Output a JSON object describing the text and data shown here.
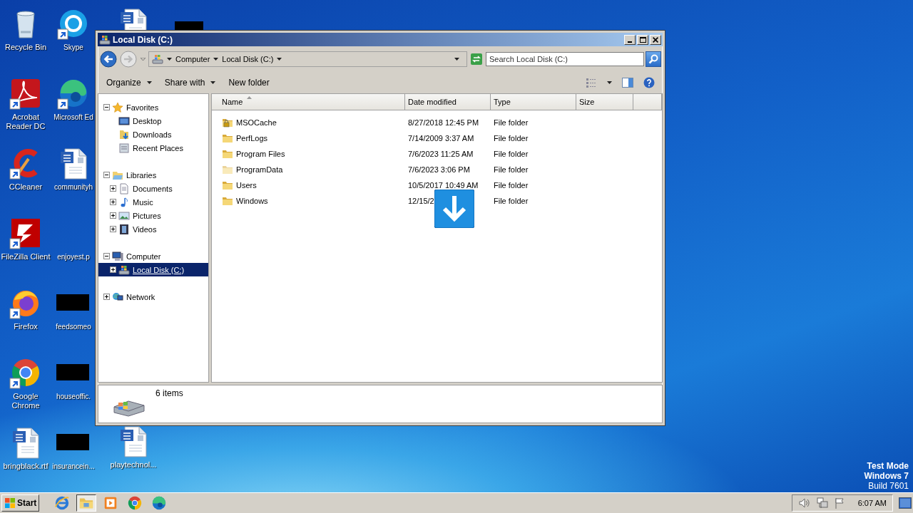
{
  "desktop": {
    "columns": [
      [
        {
          "label": "Recycle Bin",
          "kind": "recycle-bin",
          "shortcut": false
        },
        {
          "label": "Acrobat Reader DC",
          "kind": "acrobat",
          "shortcut": true
        },
        {
          "label": "CCleaner",
          "kind": "ccleaner",
          "shortcut": true
        },
        {
          "label": "FileZilla Client",
          "kind": "filezilla",
          "shortcut": true
        },
        {
          "label": "Firefox",
          "kind": "firefox",
          "shortcut": true
        },
        {
          "label": "Google Chrome",
          "kind": "chrome",
          "shortcut": true
        },
        {
          "label": "bringblack.rtf",
          "kind": "word-doc",
          "shortcut": false
        }
      ],
      [
        {
          "label": "Skype",
          "kind": "skype",
          "shortcut": true
        },
        {
          "label": "Microsoft Ed",
          "kind": "edge",
          "shortcut": true
        },
        {
          "label": "communityh",
          "kind": "word-doc",
          "shortcut": false
        },
        {
          "label": "enjoyest.p",
          "kind": "blank"
        },
        {
          "label": "feedsomeo",
          "kind": "redacted"
        },
        {
          "label": "houseoffic.",
          "kind": "redacted"
        },
        {
          "label": "insurancein...",
          "kind": "redacted"
        }
      ],
      [
        {
          "kind": "word-doc",
          "shortcut": false
        },
        {
          "label": "playtechnol...",
          "kind": "word-doc",
          "shortcut": false
        }
      ],
      [
        {
          "kind": "redacted"
        }
      ]
    ],
    "system_text": [
      "Test Mode",
      "Windows 7",
      "Build 7601"
    ]
  },
  "window": {
    "title": "Local Disk (C:)",
    "address": {
      "crumbs": [
        "Computer",
        "Local Disk (C:)"
      ]
    },
    "search": {
      "placeholder": "Search Local Disk (C:)"
    },
    "commands": [
      {
        "label": "Organize",
        "menu": true
      },
      {
        "label": "Share with",
        "menu": true
      },
      {
        "label": "New folder",
        "menu": false
      }
    ],
    "navigation": [
      {
        "label": "Favorites",
        "kind": "star",
        "expanded": true,
        "selected": false,
        "children": [
          {
            "label": "Desktop",
            "kind": "desktop",
            "selected": false
          },
          {
            "label": "Downloads",
            "kind": "downloads",
            "selected": false
          },
          {
            "label": "Recent Places",
            "kind": "recent",
            "selected": false
          }
        ]
      },
      {
        "label": "Libraries",
        "kind": "libraries",
        "expanded": true,
        "selected": false,
        "children": [
          {
            "label": "Documents",
            "kind": "documents",
            "expanded": false,
            "selected": false
          },
          {
            "label": "Music",
            "kind": "music",
            "expanded": false,
            "selected": false
          },
          {
            "label": "Pictures",
            "kind": "pictures",
            "expanded": false,
            "selected": false
          },
          {
            "label": "Videos",
            "kind": "videos",
            "expanded": false,
            "selected": false
          }
        ]
      },
      {
        "label": "Computer",
        "kind": "computer",
        "expanded": true,
        "selected": false,
        "children": [
          {
            "label": "Local Disk (C:)",
            "kind": "drive",
            "expanded": false,
            "selected": true
          }
        ]
      },
      {
        "label": "Network",
        "kind": "network",
        "expanded": false,
        "selected": false
      }
    ],
    "columns": [
      {
        "label": "Name",
        "sorted": true
      },
      {
        "label": "Date modified",
        "sorted": false
      },
      {
        "label": "Type",
        "sorted": false
      },
      {
        "label": "Size",
        "sorted": false
      }
    ],
    "files": [
      {
        "name": "MSOCache",
        "kind": "locked-folder",
        "date": "8/27/2018 12:45 PM",
        "type": "File folder"
      },
      {
        "name": "PerfLogs",
        "kind": "folder",
        "date": "7/14/2009 3:37 AM",
        "type": "File folder"
      },
      {
        "name": "Program Files",
        "kind": "folder",
        "date": "7/6/2023 11:25 AM",
        "type": "File folder"
      },
      {
        "name": "ProgramData",
        "kind": "hidden-folder",
        "date": "7/6/2023 3:06 PM",
        "type": "File folder"
      },
      {
        "name": "Users",
        "kind": "folder",
        "date": "10/5/2017 10:49 AM",
        "type": "File folder"
      },
      {
        "name": "Windows",
        "kind": "folder",
        "date": "12/15/2",
        "type": "File folder"
      }
    ],
    "status": "6 items"
  },
  "taskbar": {
    "start": "Start",
    "apps": [
      {
        "kind": "ie",
        "active": false
      },
      {
        "kind": "explorer",
        "active": true
      },
      {
        "kind": "media",
        "active": false
      },
      {
        "kind": "chrome",
        "active": false
      },
      {
        "kind": "edge",
        "active": false
      }
    ],
    "clock": "6:07 AM"
  }
}
